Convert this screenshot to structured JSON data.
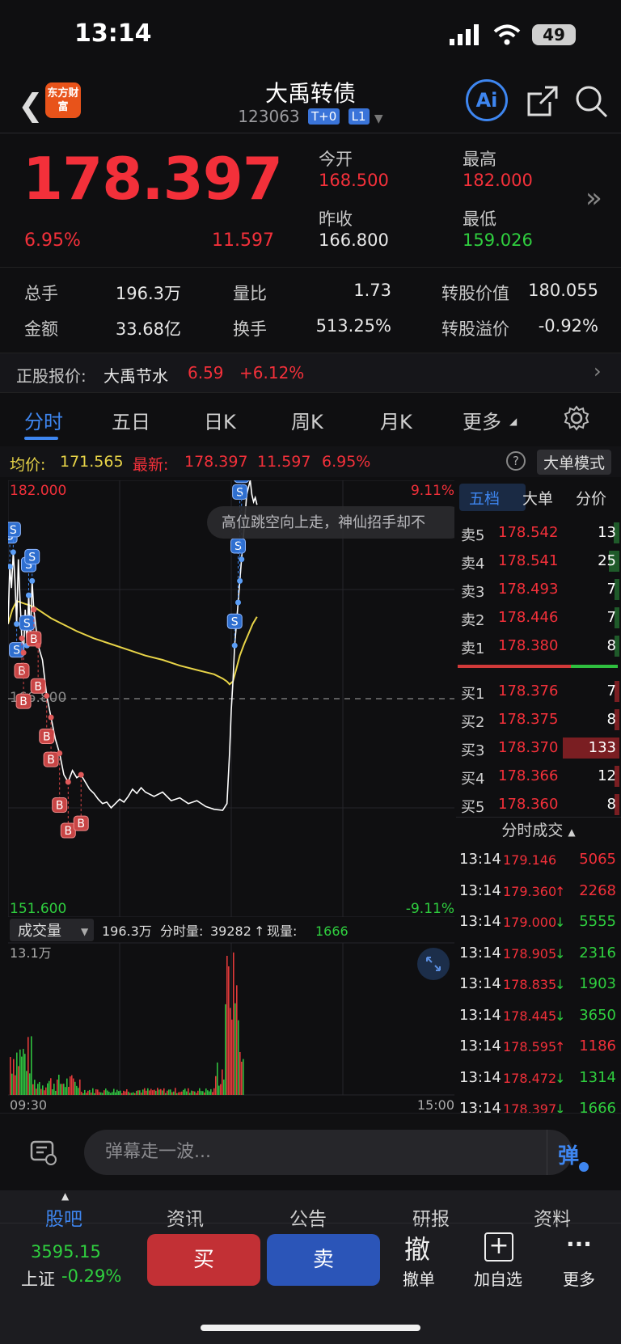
{
  "status": {
    "time": "13:14",
    "battery": "49"
  },
  "header": {
    "logo": "东方财富",
    "title": "大禹转债",
    "code": "123063",
    "tags": [
      "T+0",
      "L1"
    ],
    "ai_label": "Ai",
    "icons": [
      "back-icon",
      "share-icon",
      "search-icon"
    ]
  },
  "quote": {
    "price": "178.397",
    "change_pct": "6.95%",
    "change": "11.597",
    "open_label": "今开",
    "open": "168.500",
    "high_label": "最高",
    "high": "182.000",
    "prev_close_label": "昨收",
    "prev_close": "166.800",
    "low_label": "最低",
    "low": "159.026"
  },
  "metrics": [
    {
      "label": "总手",
      "value": "196.3万"
    },
    {
      "label": "量比",
      "value": "1.73"
    },
    {
      "label": "转股价值",
      "value": "180.055"
    },
    {
      "label": "金额",
      "value": "33.68亿"
    },
    {
      "label": "换手",
      "value": "513.25%"
    },
    {
      "label": "转股溢价",
      "value": "-0.92%"
    }
  ],
  "stock_row": {
    "label": "正股报价:",
    "name": "大禹节水",
    "price": "6.59",
    "pct": "+6.12%"
  },
  "tabs": [
    "分时",
    "五日",
    "日K",
    "周K",
    "月K",
    "更多"
  ],
  "chart_info": {
    "avg_label": "均价:",
    "avg": "171.565",
    "latest_label": "最新:",
    "latest": "178.397",
    "change": "11.597",
    "pct": "6.95%",
    "mode_button": "大单模式"
  },
  "chart_labels": {
    "top_left": "182.000",
    "top_right": "9.11%",
    "mid_left": "166.800",
    "bottom_left": "151.600",
    "bottom_right": "-9.11%",
    "bubble": "高位跳空向上走，神仙招手却不"
  },
  "volume_info": {
    "selector": "成交量",
    "total": "196.3万",
    "tick_label": "分时量:",
    "tick": "39282",
    "now_label": "现量:",
    "now": "1666",
    "max": "13.1万",
    "start": "09:30",
    "end": "15:00"
  },
  "chart_data": {
    "type": "line",
    "series": [
      {
        "name": "最新",
        "x": [
          0,
          2,
          4,
          6,
          8,
          10,
          12,
          14,
          16,
          18,
          20,
          22,
          24,
          26,
          28,
          30,
          35,
          40,
          45,
          50,
          55,
          60,
          65,
          70,
          75,
          80,
          85,
          90,
          95,
          100,
          105,
          110,
          115,
          120,
          125,
          130,
          135,
          140,
          145,
          150,
          155,
          160,
          170,
          180,
          190,
          200,
          210,
          220,
          230,
          240,
          250,
          255,
          258,
          260,
          262,
          264,
          266,
          268,
          270,
          272,
          274,
          276,
          278,
          280,
          282,
          284,
          286,
          288,
          290
        ],
        "y": [
          172.0,
          176.0,
          174.5,
          177.0,
          175.0,
          172.0,
          176.5,
          173.5,
          171.0,
          170.0,
          173.0,
          170.5,
          174.0,
          171.0,
          175.0,
          173.0,
          170.5,
          169.5,
          167.0,
          165.5,
          164.0,
          163.0,
          161.5,
          161.0,
          161.8,
          161.3,
          161.5,
          161.0,
          160.5,
          160.2,
          159.8,
          159.5,
          159.6,
          159.2,
          159.5,
          159.8,
          159.6,
          160.0,
          160.5,
          160.2,
          160.6,
          160.3,
          160.0,
          160.3,
          159.7,
          159.9,
          159.5,
          159.7,
          159.3,
          159.1,
          159.03,
          159.5,
          163.0,
          166.0,
          168.0,
          170.5,
          172.0,
          173.5,
          175.0,
          176.5,
          178.0,
          179.5,
          181.0,
          181.5,
          182.0,
          181.0,
          180.5,
          180.8,
          180.3
        ]
      },
      {
        "name": "均价",
        "x": [
          0,
          5,
          10,
          20,
          30,
          40,
          50,
          60,
          80,
          100,
          120,
          140,
          160,
          180,
          200,
          220,
          240,
          250,
          255,
          258,
          262,
          266,
          270,
          275,
          280,
          285,
          290
        ],
        "y": [
          172.0,
          173.0,
          173.6,
          173.4,
          173.2,
          172.8,
          172.4,
          172.1,
          171.5,
          171.0,
          170.6,
          170.2,
          169.8,
          169.5,
          169.1,
          168.8,
          168.5,
          168.2,
          168.0,
          167.8,
          168.0,
          168.9,
          169.8,
          170.6,
          171.3,
          172.0,
          172.5
        ]
      }
    ],
    "ylim": [
      151.6,
      182.0
    ],
    "xlim": [
      0,
      520
    ]
  },
  "orderbook": {
    "tabs": [
      "五档",
      "大单",
      "分价"
    ],
    "asks": [
      {
        "label": "卖5",
        "price": "178.542",
        "vol": "13"
      },
      {
        "label": "卖4",
        "price": "178.541",
        "vol": "25"
      },
      {
        "label": "卖3",
        "price": "178.493",
        "vol": "7"
      },
      {
        "label": "卖2",
        "price": "178.446",
        "vol": "7"
      },
      {
        "label": "卖1",
        "price": "178.380",
        "vol": "8"
      }
    ],
    "bids": [
      {
        "label": "买1",
        "price": "178.376",
        "vol": "7"
      },
      {
        "label": "买2",
        "price": "178.375",
        "vol": "8"
      },
      {
        "label": "买3",
        "price": "178.370",
        "vol": "133"
      },
      {
        "label": "买4",
        "price": "178.366",
        "vol": "12"
      },
      {
        "label": "买5",
        "price": "178.360",
        "vol": "8"
      }
    ],
    "trades_title": "分时成交",
    "trades": [
      {
        "time": "13:14",
        "price": "179.146",
        "arrow": "",
        "vol": "5065",
        "dir": "up"
      },
      {
        "time": "13:14",
        "price": "179.360",
        "arrow": "↑",
        "vol": "2268",
        "dir": "up"
      },
      {
        "time": "13:14",
        "price": "179.000",
        "arrow": "↓",
        "vol": "5555",
        "dir": "down"
      },
      {
        "time": "13:14",
        "price": "178.905",
        "arrow": "↓",
        "vol": "2316",
        "dir": "down"
      },
      {
        "time": "13:14",
        "price": "178.835",
        "arrow": "↓",
        "vol": "1903",
        "dir": "down"
      },
      {
        "time": "13:14",
        "price": "178.445",
        "arrow": "↓",
        "vol": "3650",
        "dir": "down"
      },
      {
        "time": "13:14",
        "price": "178.595",
        "arrow": "↑",
        "vol": "1186",
        "dir": "up"
      },
      {
        "time": "13:14",
        "price": "178.472",
        "arrow": "↓",
        "vol": "1314",
        "dir": "down"
      },
      {
        "time": "13:14",
        "price": "178.397",
        "arrow": "↓",
        "vol": "1666",
        "dir": "down"
      }
    ]
  },
  "comment": {
    "placeholder": "弹幕走一波...",
    "danmu": "弹"
  },
  "bottom": {
    "tabs": [
      "股吧",
      "资讯",
      "公告",
      "研报",
      "资料"
    ],
    "index_value": "3595.15",
    "index_name": "上证",
    "index_pct": "-0.29%",
    "buy": "买",
    "sell": "卖",
    "cancel_glyph": "撤",
    "cancel": "撤单",
    "add_glyph": "+",
    "add": "加自选",
    "more_glyph": "···",
    "more": "更多"
  },
  "colors": {
    "up": "#f3303a",
    "down": "#2fcf3f",
    "accent": "#3e86f0",
    "avg_line": "#e8d448"
  }
}
